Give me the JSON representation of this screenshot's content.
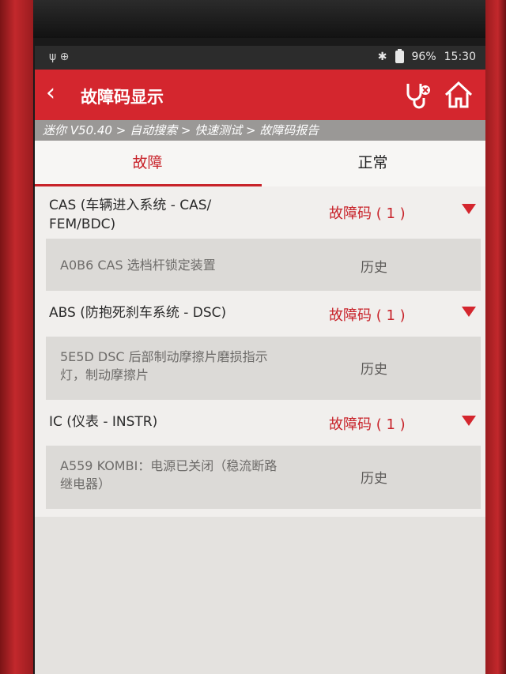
{
  "status_bar": {
    "left_icons": "ψ ⊕",
    "battery": "96%",
    "time": "15:30"
  },
  "header": {
    "title": "故障码显示"
  },
  "breadcrumb": "迷你 V50.40 > 自动搜索 > 快速测试 > 故障码报告",
  "tabs": [
    {
      "label": "故障",
      "active": true
    },
    {
      "label": "正常",
      "active": false
    }
  ],
  "groups": [
    {
      "name": "CAS (车辆进入系统 - CAS/ FEM/BDC)",
      "count": "故障码 ( 1 )",
      "codes": [
        {
          "description": "A0B6 CAS 选档杆锁定装置",
          "status": "历史"
        }
      ]
    },
    {
      "name": "ABS (防抱死刹车系统 - DSC)",
      "count": "故障码 ( 1 )",
      "codes": [
        {
          "description": "5E5D DSC 后部制动摩擦片磨损指示灯，制动摩擦片",
          "status": "历史"
        }
      ]
    },
    {
      "name": "IC (仪表 - INSTR)",
      "count": "故障码 ( 1 )",
      "codes": [
        {
          "description": "A559 KOMBI：电源已关闭（稳流断路继电器）",
          "status": "历史"
        }
      ]
    }
  ],
  "colors": {
    "accent": "#d4262e",
    "breadcrumb_bg": "#9a9896"
  }
}
